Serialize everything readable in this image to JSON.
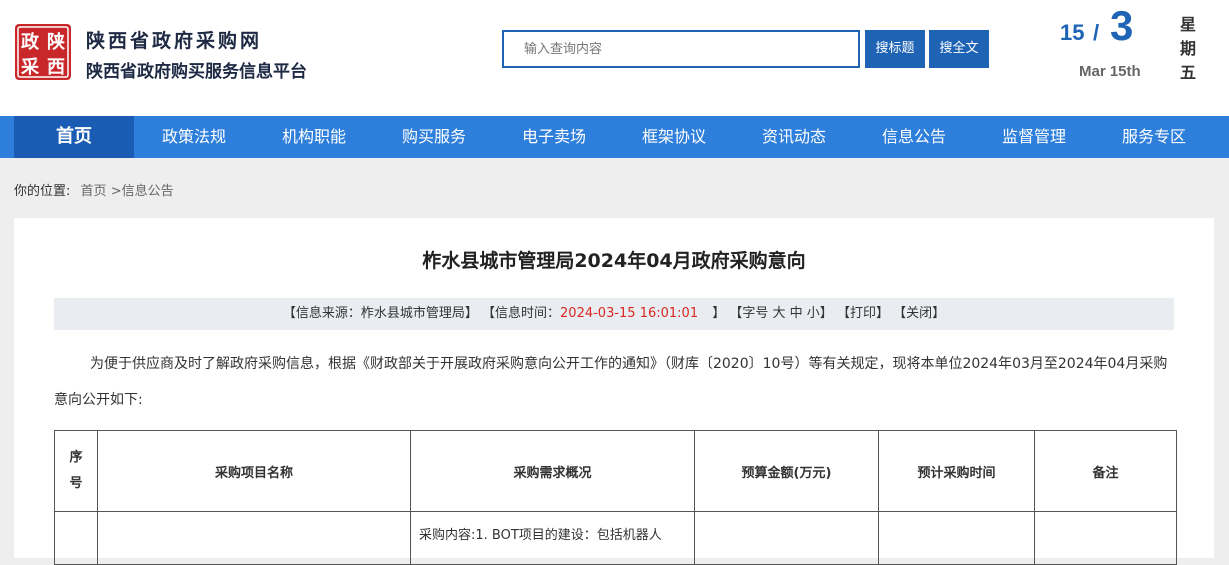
{
  "header": {
    "logo_text": "政陕采西",
    "site_title": "陕西省政府采购网",
    "site_subtitle": "陕西省政府购买服务信息平台",
    "search": {
      "placeholder": "输入查询内容",
      "value": ""
    },
    "search_title_button": "搜标题",
    "search_full_button": "搜全文",
    "date": {
      "day": "15",
      "slash": "/",
      "month": "3",
      "english": "Mar 15th",
      "weekday": [
        "星",
        "期",
        "五"
      ]
    }
  },
  "nav": {
    "items": [
      "首页",
      "政策法规",
      "机构职能",
      "购买服务",
      "电子卖场",
      "框架协议",
      "资讯动态",
      "信息公告",
      "监督管理",
      "服务专区"
    ],
    "active": "首页"
  },
  "breadcrumb": {
    "label": "你的位置:",
    "home": "首页",
    "current": ">信息公告"
  },
  "article": {
    "title": "柞水县城市管理局2024年04月政府采购意向",
    "meta": {
      "source_label": "【信息来源：柞水县城市管理局】",
      "time_label": "【信息时间：",
      "time_value": "2024-03-15 16:01:01",
      "time_close": "】",
      "font_label": "【字号 大 中 小】",
      "print_label": "【打印】",
      "close_label": "【关闭】"
    },
    "intro": "为便于供应商及时了解政府采购信息，根据《财政部关于开展政府采购意向公开工作的通知》（财库〔2020〕10号）等有关规定，现将本单位2024年03月至2024年04月采购意向公开如下:"
  },
  "table": {
    "headers": [
      "序号",
      "采购项目名称",
      "采购需求概况",
      "预算金额(万元)",
      "预计采购时间",
      "备注"
    ],
    "rows": [
      [
        "",
        "",
        "采购内容:1. BOT项目的建设：包括机器人",
        "",
        "",
        ""
      ]
    ]
  },
  "colors": {
    "primary": "#1e63b4",
    "nav": "#2e7fdb",
    "nav_active": "#1a5bb4",
    "time_red": "#d8281f",
    "logo_red": "#c9282a"
  }
}
